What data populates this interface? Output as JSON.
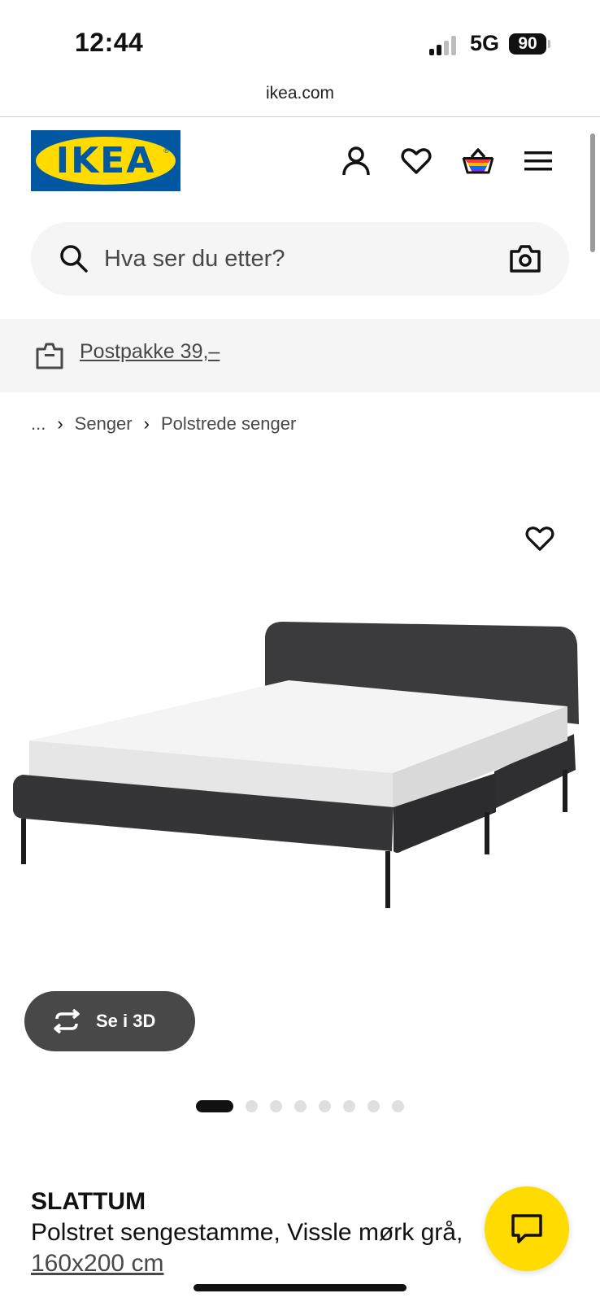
{
  "status_bar": {
    "time": "12:44",
    "network": "5G",
    "battery": "90"
  },
  "browser": {
    "url": "ikea.com"
  },
  "header": {
    "logo_text": "IKEA",
    "logo_mark": "®",
    "icons": [
      "account-icon",
      "wishlist-icon",
      "cart-icon",
      "menu-icon"
    ]
  },
  "search": {
    "placeholder": "Hva ser du etter?"
  },
  "banner": {
    "text": "Postpakke 39,–"
  },
  "breadcrumb": {
    "items": [
      "...",
      "Senger",
      "Polstrede senger"
    ]
  },
  "gallery": {
    "see_3d_label": "Se i 3D",
    "image_count": 8,
    "active_index": 0
  },
  "product": {
    "name": "SLATTUM",
    "description": "Polstret sengestamme, Vissle mørk grå,",
    "size": "160x200 cm"
  },
  "colors": {
    "ikea_blue": "#0058a3",
    "ikea_yellow": "#ffdb00",
    "text_dark": "#111111",
    "text_grey": "#484848",
    "surface_grey": "#f5f5f5"
  }
}
